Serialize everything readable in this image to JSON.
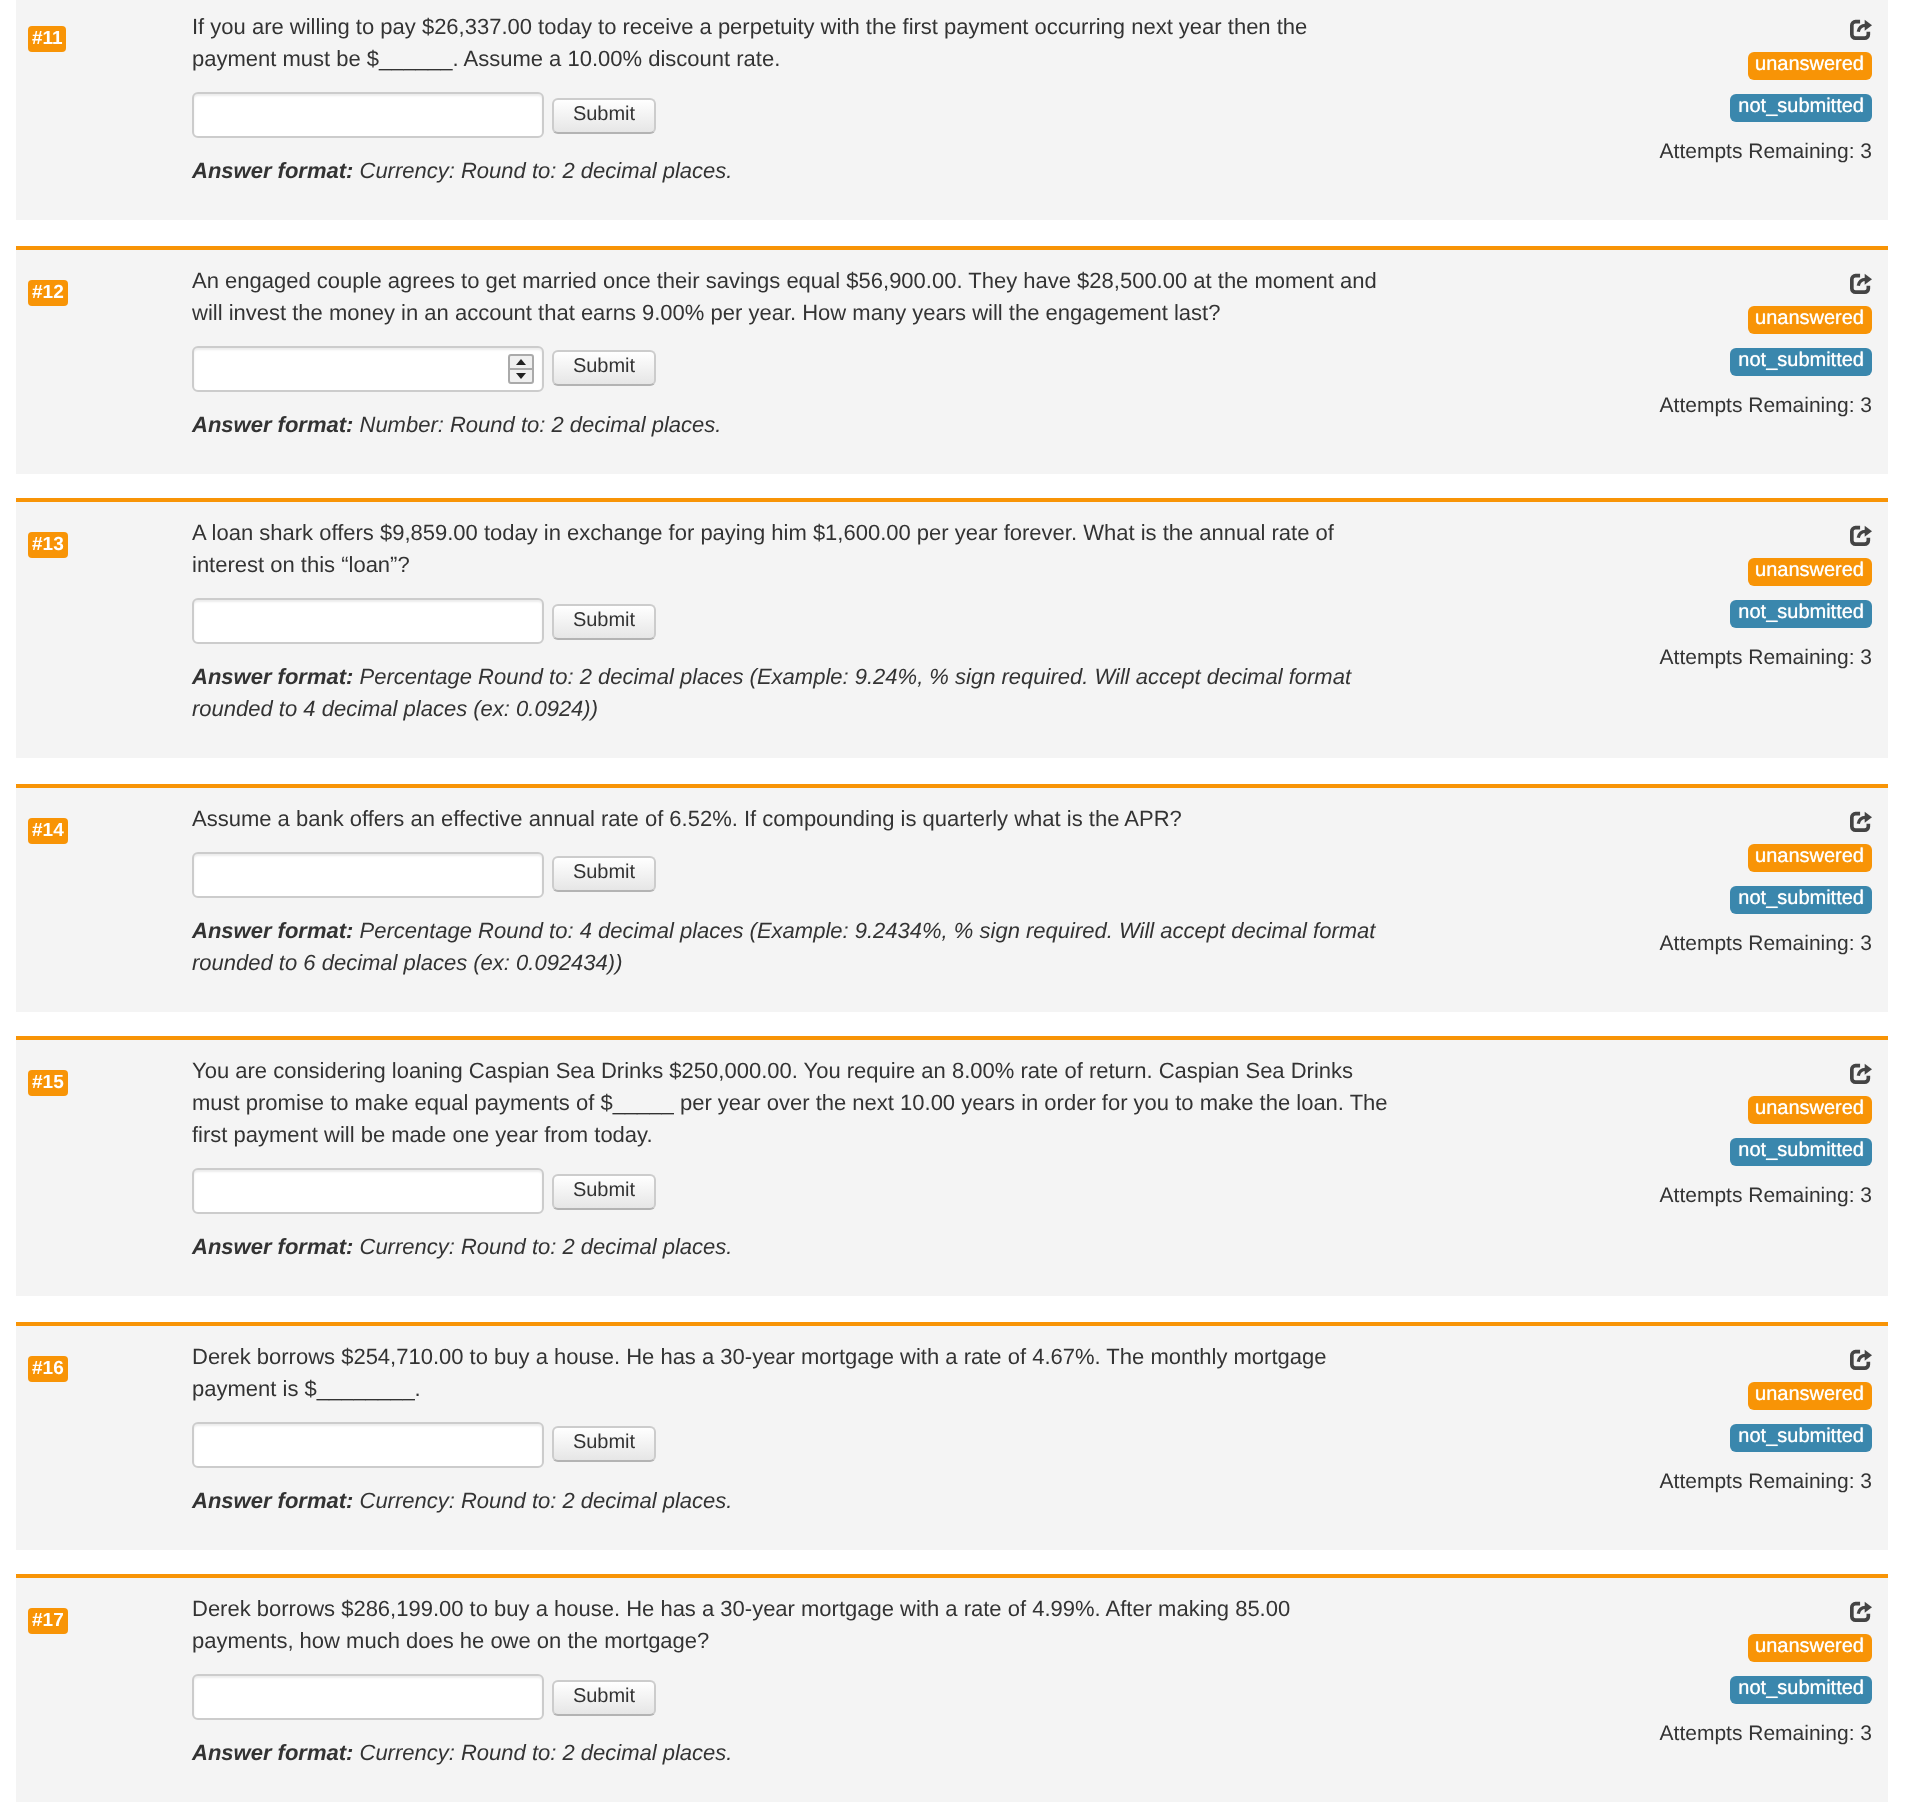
{
  "questions": [
    {
      "number": "#11",
      "text": "If you are willing to pay $26,337.00 today to receive a perpetuity with the first payment occurring next year then the payment must be $______. Assume a 10.00% discount rate.",
      "input": {
        "kind": "text"
      },
      "submit_label": "Submit",
      "answer_format": "**Answer format:** Currency: Round to: 2 decimal places.",
      "badges": [
        {
          "label": "unanswered",
          "color": "#f89406"
        },
        {
          "label": "not_submitted",
          "color": "#3a87ad"
        }
      ],
      "attempts": "Attempts Remaining: 3"
    },
    {
      "number": "#12",
      "text": "An engaged couple agrees to get married once their savings equal $56,900.00. They have $28,500.00 at the moment and will invest the money in an account that earns 9.00% per year. How many years will the engagement last?",
      "input": {
        "kind": "number"
      },
      "submit_label": "Submit",
      "answer_format": "**Answer format:** Number: Round to: 2 decimal places.",
      "badges": [
        {
          "label": "unanswered",
          "color": "#f89406"
        },
        {
          "label": "not_submitted",
          "color": "#3a87ad"
        }
      ],
      "attempts": "Attempts Remaining: 3"
    },
    {
      "number": "#13",
      "text": "A loan shark offers $9,859.00 today in exchange for paying him $1,600.00 per year forever. What is the annual rate of interest on this “loan”?",
      "input": {
        "kind": "text"
      },
      "submit_label": "Submit",
      "answer_format": "**Answer format:** Percentage Round to: 2 decimal places (Example: 9.24%, % sign required. Will accept decimal format rounded to 4 decimal places (ex: 0.0924))",
      "badges": [
        {
          "label": "unanswered",
          "color": "#f89406"
        },
        {
          "label": "not_submitted",
          "color": "#3a87ad"
        }
      ],
      "attempts": "Attempts Remaining: 3"
    },
    {
      "number": "#14",
      "text": "Assume a bank offers an effective annual rate of 6.52%. If compounding is quarterly what is the APR?",
      "input": {
        "kind": "text"
      },
      "submit_label": "Submit",
      "answer_format": "**Answer format:** Percentage Round to: 4 decimal places (Example: 9.2434%, % sign required. Will accept decimal format rounded to 6 decimal places (ex: 0.092434))",
      "badges": [
        {
          "label": "unanswered",
          "color": "#f89406"
        },
        {
          "label": "not_submitted",
          "color": "#3a87ad"
        }
      ],
      "attempts": "Attempts Remaining: 3"
    },
    {
      "number": "#15",
      "text": "You are considering loaning Caspian Sea Drinks $250,000.00. You require an 8.00% rate of return. Caspian Sea Drinks must promise to make equal payments of $_____ per year over the next 10.00 years in order for you to make the loan. The first payment will be made one year from today.",
      "input": {
        "kind": "text"
      },
      "submit_label": "Submit",
      "answer_format": "**Answer format:** Currency: Round to: 2 decimal places.",
      "badges": [
        {
          "label": "unanswered",
          "color": "#f89406"
        },
        {
          "label": "not_submitted",
          "color": "#3a87ad"
        }
      ],
      "attempts": "Attempts Remaining: 3"
    },
    {
      "number": "#16",
      "text": "Derek borrows $254,710.00 to buy a house. He has a 30-year mortgage with a rate of 4.67%. The monthly mortgage payment is $________.",
      "input": {
        "kind": "text"
      },
      "submit_label": "Submit",
      "answer_format": "**Answer format:** Currency: Round to: 2 decimal places.",
      "badges": [
        {
          "label": "unanswered",
          "color": "#f89406"
        },
        {
          "label": "not_submitted",
          "color": "#3a87ad"
        }
      ],
      "attempts": "Attempts Remaining: 3"
    },
    {
      "number": "#17",
      "text": "Derek borrows $286,199.00 to buy a house. He has a 30-year mortgage with a rate of 4.99%. After making 85.00 payments, how much does he owe on the mortgage?",
      "input": {
        "kind": "text"
      },
      "submit_label": "Submit",
      "answer_format": "**Answer format:** Currency: Round to: 2 decimal places.",
      "badges": [
        {
          "label": "unanswered",
          "color": "#f89406"
        },
        {
          "label": "not_submitted",
          "color": "#3a87ad"
        }
      ],
      "attempts": "Attempts Remaining: 3"
    }
  ]
}
